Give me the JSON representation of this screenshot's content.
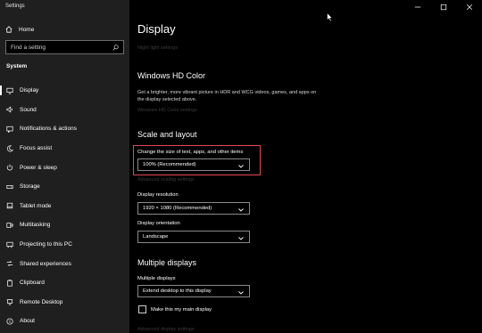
{
  "app": {
    "title": "Settings"
  },
  "window": {
    "minimize": "–",
    "maximize": "□",
    "close": "✕"
  },
  "sidebar": {
    "home_label": "Home",
    "search_placeholder": "Find a setting",
    "section_header": "System",
    "items": [
      {
        "label": "Display",
        "icon": "monitor-icon",
        "active": true
      },
      {
        "label": "Sound",
        "icon": "speaker-icon"
      },
      {
        "label": "Notifications & actions",
        "icon": "notification-icon"
      },
      {
        "label": "Focus assist",
        "icon": "moon-icon"
      },
      {
        "label": "Power & sleep",
        "icon": "power-icon"
      },
      {
        "label": "Storage",
        "icon": "storage-icon"
      },
      {
        "label": "Tablet mode",
        "icon": "tablet-icon"
      },
      {
        "label": "Multitasking",
        "icon": "multitasking-icon"
      },
      {
        "label": "Projecting to this PC",
        "icon": "projecting-icon"
      },
      {
        "label": "Shared experiences",
        "icon": "shared-icon"
      },
      {
        "label": "Clipboard",
        "icon": "clipboard-icon"
      },
      {
        "label": "Remote Desktop",
        "icon": "remote-desktop-icon"
      },
      {
        "label": "About",
        "icon": "info-icon"
      }
    ]
  },
  "main": {
    "page_title": "Display",
    "night_light_link": "Night light settings",
    "hdr": {
      "heading": "Windows HD Color",
      "description": "Get a brighter, more vibrant picture in HDR and WCG videos, games, and apps on the display selected above.",
      "link": "Windows HD Color settings"
    },
    "scale": {
      "heading": "Scale and layout",
      "size_label": "Change the size of text, apps, and other items",
      "size_value": "100% (Recommended)",
      "advanced_link": "Advanced scaling settings",
      "resolution_label": "Display resolution",
      "resolution_value": "1920 × 1080 (Recommended)",
      "orientation_label": "Display orientation",
      "orientation_value": "Landscape"
    },
    "multiple": {
      "heading": "Multiple displays",
      "label": "Multiple displays",
      "value": "Extend desktop to this display",
      "main_display_checkbox": "Make this my main display",
      "advanced_link": "Advanced display settings"
    }
  },
  "colors": {
    "highlight": "#e04a55",
    "sidebar_bg": "#1f1f1f",
    "main_bg": "#000000"
  }
}
